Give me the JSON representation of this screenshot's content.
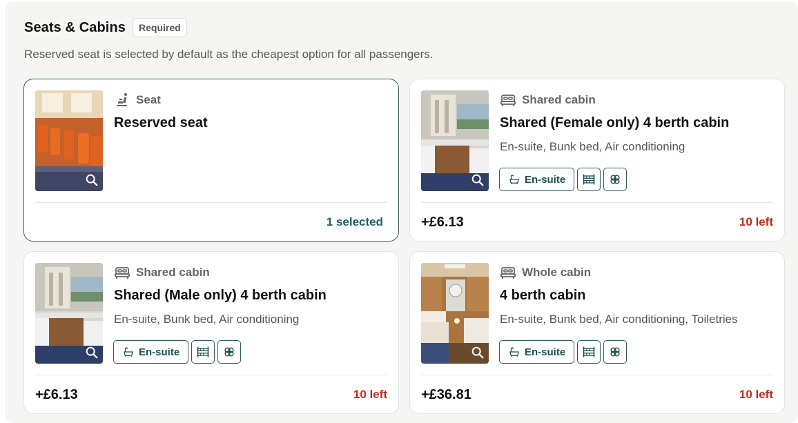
{
  "section": {
    "title": "Seats & Cabins",
    "badge": "Required",
    "subtitle": "Reserved seat is selected by default as the cheapest option for all passengers."
  },
  "cards": [
    {
      "category": "Seat",
      "category_icon": "seat-icon",
      "title": "Reserved seat",
      "description": "",
      "status": "1 selected",
      "selected": true
    },
    {
      "category": "Shared cabin",
      "category_icon": "bed-icon",
      "title": "Shared (Female only) 4 berth cabin",
      "description": "En-suite, Bunk bed, Air conditioning",
      "features": [
        "En-suite",
        "bunk-bed-icon",
        "air-conditioning-icon"
      ],
      "price": "+£6.13",
      "availability": "10 left"
    },
    {
      "category": "Shared cabin",
      "category_icon": "bed-icon",
      "title": "Shared (Male only) 4 berth cabin",
      "description": "En-suite, Bunk bed, Air conditioning",
      "features": [
        "En-suite",
        "bunk-bed-icon",
        "air-conditioning-icon"
      ],
      "price": "+£6.13",
      "availability": "10 left"
    },
    {
      "category": "Whole cabin",
      "category_icon": "bed-icon",
      "title": "4 berth cabin",
      "description": "En-suite, Bunk bed, Air conditioning, Toiletries",
      "features": [
        "En-suite",
        "bunk-bed-icon",
        "air-conditioning-icon"
      ],
      "price": "+£36.81",
      "availability": "10 left"
    }
  ],
  "colors": {
    "accent": "#2f5f5f",
    "availability": "#c8261d",
    "background": "#f5f5f3"
  }
}
